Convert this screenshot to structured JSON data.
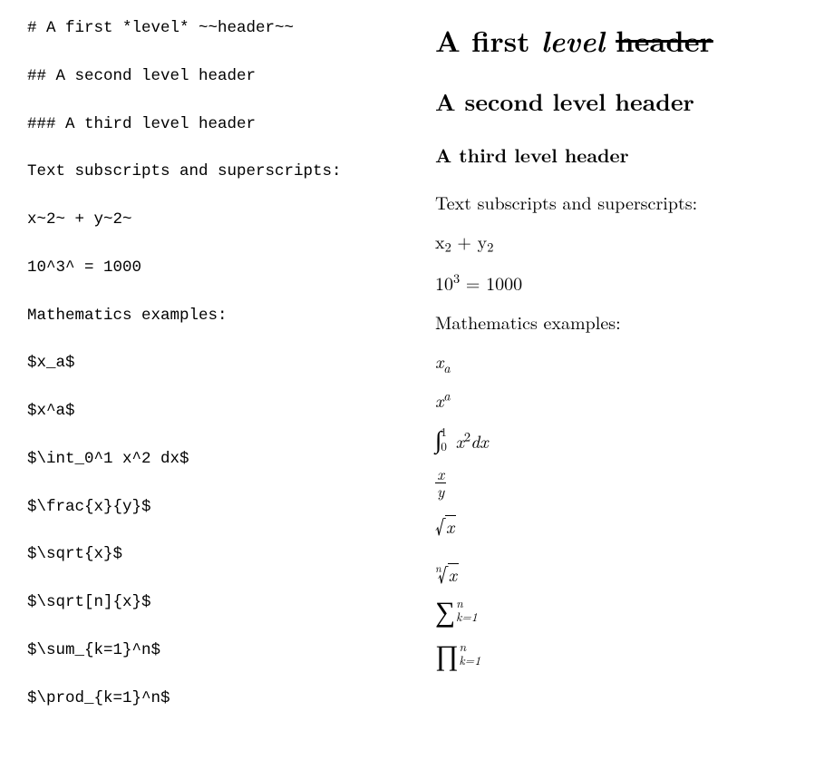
{
  "source": {
    "lines": [
      "# A first *level* ~~header~~",
      "## A second level header",
      "### A third level header",
      "Text subscripts and superscripts:",
      "x~2~ + y~2~",
      "10^3^ = 1000",
      "Mathematics examples:",
      "$x_a$",
      "$x^a$",
      "$\\int_0^1 x^2 dx$",
      "$\\frac{x}{y}$",
      "$\\sqrt{x}$",
      "$\\sqrt[n]{x}$",
      "$\\sum_{k=1}^n$",
      "$\\prod_{k=1}^n$"
    ]
  },
  "rendered": {
    "h1_pre": "A first ",
    "h1_em": "level",
    "h1_strike": "header",
    "h2": "A second level header",
    "h3": "A third level header",
    "p_subsup": "Text subscripts and superscripts:",
    "xy_x": "x",
    "xy_plus": " + ",
    "xy_y": "y",
    "xy_sub": "2",
    "pow_base": "10",
    "pow_exp": "3",
    "pow_rhs": " = 1000",
    "p_math": "Mathematics examples:",
    "xa_x": "x",
    "xa_a": "a",
    "xA_x": "x",
    "xA_a": "a",
    "int_lo": "0",
    "int_hi": "1",
    "int_x": "x",
    "int_p": "2",
    "int_dx": "dx",
    "frac_n": "x",
    "frac_d": "y",
    "sqrt_x": "x",
    "nroot_n": "n",
    "nroot_x": "x",
    "sum_hi": "n",
    "sum_lo": "k=1",
    "prod_hi": "n",
    "prod_lo": "k=1"
  }
}
